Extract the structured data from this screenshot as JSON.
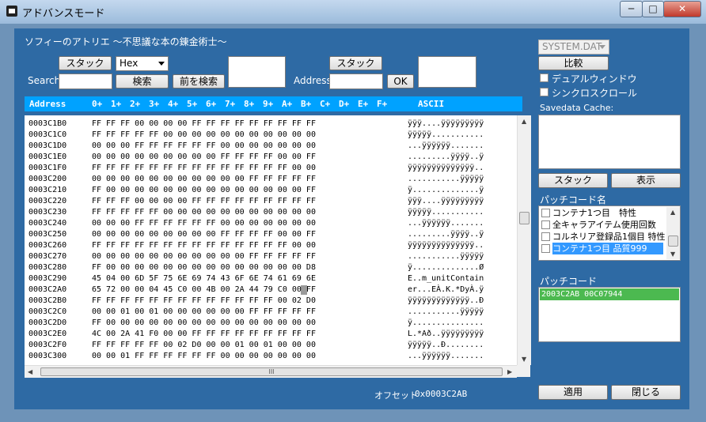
{
  "window": {
    "title": "アドバンスモード",
    "min": "─",
    "max": "□",
    "close": "✕"
  },
  "header": {
    "game_title": "ソフィーのアトリエ ～不思議な本の錬金術士～"
  },
  "search": {
    "stack_label": "スタック",
    "mode_value": "Hex",
    "search_label": "Search",
    "search_button": "検索",
    "prev_search_button": "前を検索"
  },
  "address": {
    "stack_label": "スタック",
    "label": "Address",
    "ok_button": "OK"
  },
  "hex": {
    "header": {
      "address": "Address",
      "cols": [
        "0+",
        "1+",
        "2+",
        "3+",
        "4+",
        "5+",
        "6+",
        "7+",
        "8+",
        "9+",
        "A+",
        "B+",
        "C+",
        "D+",
        "E+",
        "F+"
      ],
      "ascii": "ASCII"
    },
    "rows": [
      {
        "addr": "0003C1B0",
        "bytes": "FF FF FF 00 00 00 00 FF FF FF FF FF FF FF FF FF",
        "ascii": "ÿÿÿ....ÿÿÿÿÿÿÿÿÿ"
      },
      {
        "addr": "0003C1C0",
        "bytes": "FF FF FF FF FF 00 00 00 00 00 00 00 00 00 00 00",
        "ascii": "ÿÿÿÿÿ..........."
      },
      {
        "addr": "0003C1D0",
        "bytes": "00 00 00 FF FF FF FF FF FF 00 00 00 00 00 00 00",
        "ascii": "...ÿÿÿÿÿÿ......."
      },
      {
        "addr": "0003C1E0",
        "bytes": "00 00 00 00 00 00 00 00 00 FF FF FF FF 00 00 FF",
        "ascii": ".........ÿÿÿÿ..ÿ"
      },
      {
        "addr": "0003C1F0",
        "bytes": "FF FF FF FF FF FF FF FF FF FF FF FF FF FF 00 00",
        "ascii": "ÿÿÿÿÿÿÿÿÿÿÿÿÿÿ.."
      },
      {
        "addr": "0003C200",
        "bytes": "00 00 00 00 00 00 00 00 00 00 00 FF FF FF FF FF",
        "ascii": "...........ÿÿÿÿÿ"
      },
      {
        "addr": "0003C210",
        "bytes": "FF 00 00 00 00 00 00 00 00 00 00 00 00 00 00 FF",
        "ascii": "ÿ..............ÿ"
      },
      {
        "addr": "0003C220",
        "bytes": "FF FF FF 00 00 00 00 FF FF FF FF FF FF FF FF FF",
        "ascii": "ÿÿÿ....ÿÿÿÿÿÿÿÿÿ"
      },
      {
        "addr": "0003C230",
        "bytes": "FF FF FF FF FF 00 00 00 00 00 00 00 00 00 00 00",
        "ascii": "ÿÿÿÿÿ..........."
      },
      {
        "addr": "0003C240",
        "bytes": "00 00 00 FF FF FF FF FF FF 00 00 00 00 00 00 00",
        "ascii": "...ÿÿÿÿÿÿ......."
      },
      {
        "addr": "0003C250",
        "bytes": "00 00 00 00 00 00 00 00 00 FF FF FF FF 00 00 FF",
        "ascii": ".........ÿÿÿÿ..ÿ"
      },
      {
        "addr": "0003C260",
        "bytes": "FF FF FF FF FF FF FF FF FF FF FF FF FF FF 00 00",
        "ascii": "ÿÿÿÿÿÿÿÿÿÿÿÿÿÿ.."
      },
      {
        "addr": "0003C270",
        "bytes": "00 00 00 00 00 00 00 00 00 00 00 FF FF FF FF FF",
        "ascii": "...........ÿÿÿÿÿ"
      },
      {
        "addr": "0003C280",
        "bytes": "FF 00 00 00 00 00 00 00 00 00 00 00 00 00 00 D8",
        "ascii": "ÿ..............Ø"
      },
      {
        "addr": "0003C290",
        "bytes": "45 04 00 6D 5F 75 6E 69 74 43 6F 6E 74 61 69 6E",
        "ascii": "E..m_unitContain"
      },
      {
        "addr": "0003C2A0",
        "bytes": "65 72 00 00 04 45 C0 00 4B 00 2A 44 79 C0 00 FF",
        "ascii": "er...EÀ.K.*DyÀ.ÿ"
      },
      {
        "addr": "0003C2B0",
        "bytes": "FF FF FF FF FF FF FF FF FF FF FF FF FF 00 02 D0",
        "ascii": "ÿÿÿÿÿÿÿÿÿÿÿÿÿ..Ð"
      },
      {
        "addr": "0003C2C0",
        "bytes": "00 00 01 00 01 00 00 00 00 00 00 FF FF FF FF FF",
        "ascii": "...........ÿÿÿÿÿ"
      },
      {
        "addr": "0003C2D0",
        "bytes": "FF 00 00 00 00 00 00 00 00 00 00 00 00 00 00 00",
        "ascii": "ÿ..............."
      },
      {
        "addr": "0003C2E0",
        "bytes": "4C 00 2A 41 F0 00 00 FF FF FF FF FF FF FF FF FF",
        "ascii": "L.*Að..ÿÿÿÿÿÿÿÿÿ"
      },
      {
        "addr": "0003C2F0",
        "bytes": "FF FF FF FF FF 00 02 D0 00 00 01 00 01 00 00 00",
        "ascii": "ÿÿÿÿÿ..Ð........"
      },
      {
        "addr": "0003C300",
        "bytes": "00 00 01 FF FF FF FF FF FF 00 00 00 00 00 00 00",
        "ascii": "...ÿÿÿÿÿÿ......."
      }
    ],
    "offset_label": "オフセット",
    "offset_value": "0x0003C2AB",
    "hscroll_grip": "III"
  },
  "side": {
    "file_select": "SYSTEM.DAT",
    "compare_button": "比較",
    "dual_window": "デュアルウィンドウ",
    "sync_scroll": "シンクロスクロール",
    "cache_label": "Savedata Cache:",
    "stack_button": "スタック",
    "show_button": "表示",
    "patch_names_label": "パッチコード名",
    "patch_names": [
      "コンテナ1つ目　特性",
      "全キャラアイテム使用回数",
      "コルネリア登録品1個目 特性",
      "コンテナ1つ目 品質999"
    ],
    "patch_code_label": "パッチコード",
    "patch_code_value": "2003C2AB 00C07944"
  },
  "footer": {
    "apply_button": "適用",
    "close_button": "閉じる"
  },
  "colors": {
    "client_bg": "#2e6aa4",
    "hex_header": "#00a2ff",
    "selected": "#3399ff",
    "patch_selected": "#4cb950"
  }
}
